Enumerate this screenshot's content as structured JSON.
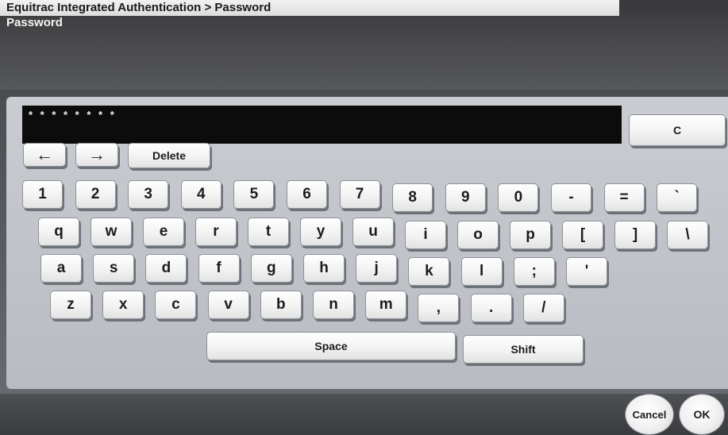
{
  "header": {
    "breadcrumb": "Equitrac Integrated Authentication > Password",
    "title": "Password"
  },
  "password_field": {
    "value": "* * * * * * * *"
  },
  "edit_keys": {
    "clear": "C",
    "left_arrow": "←",
    "right_arrow": "→",
    "delete": "Delete"
  },
  "keyboard": {
    "row1": [
      "1",
      "2",
      "3",
      "4",
      "5",
      "6",
      "7",
      "8",
      "9",
      "0",
      "-",
      "=",
      "`"
    ],
    "row2": [
      "q",
      "w",
      "e",
      "r",
      "t",
      "y",
      "u",
      "i",
      "o",
      "p",
      "[",
      "]",
      "\\"
    ],
    "row3": [
      "a",
      "s",
      "d",
      "f",
      "g",
      "h",
      "j",
      "k",
      "l",
      ";",
      "'"
    ],
    "row4": [
      "z",
      "x",
      "c",
      "v",
      "b",
      "n",
      "m",
      ",",
      ".",
      "/"
    ],
    "space": "Space",
    "shift": "Shift"
  },
  "footer": {
    "cancel": "Cancel",
    "ok": "OK"
  }
}
